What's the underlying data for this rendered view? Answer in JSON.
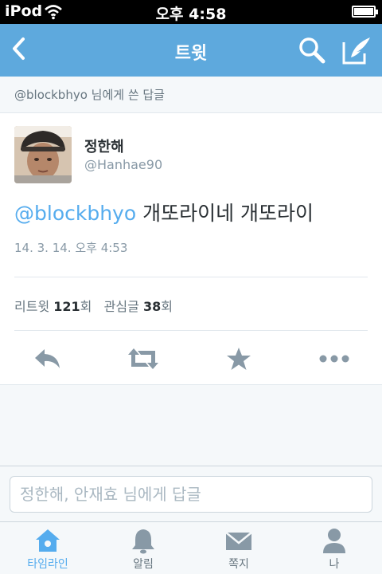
{
  "status_bar": {
    "device": "iPod",
    "time": "오후 4:58",
    "battery_level": 0.95
  },
  "nav": {
    "title": "트윗",
    "icons": [
      "back-arrow-icon",
      "search-icon",
      "compose-icon"
    ]
  },
  "reply_context": {
    "text": "@blockbhyo 님에게 쓴 답글"
  },
  "tweet": {
    "display_name": "정한해",
    "handle": "@Hanhae90",
    "mention": "@blockbhyo",
    "body": " 개또라이네 개또라이",
    "timestamp": "14. 3. 14. 오후 4:53",
    "stats": {
      "retweets_label": "리트윗",
      "retweets_count": "121",
      "retweets_unit": "회",
      "favorites_label": "관심글",
      "favorites_count": "38",
      "favorites_unit": "회"
    },
    "action_icons": [
      "reply-icon",
      "retweet-icon",
      "favorite-star-icon",
      "more-dots-icon"
    ]
  },
  "composer": {
    "placeholder": "정한해, 안재효 님에게 답글",
    "value": ""
  },
  "tabs": [
    {
      "label": "타임라인",
      "icon": "home-icon",
      "active": true
    },
    {
      "label": "알림",
      "icon": "bell-icon",
      "active": false
    },
    {
      "label": "쪽지",
      "icon": "envelope-icon",
      "active": false
    },
    {
      "label": "나",
      "icon": "person-icon",
      "active": false
    }
  ],
  "colors": {
    "accent": "#55acee",
    "nav_bar": "#5ea9dd",
    "action_icon": "#8899a6",
    "text_primary": "#292f33",
    "text_secondary": "#8899a6"
  }
}
